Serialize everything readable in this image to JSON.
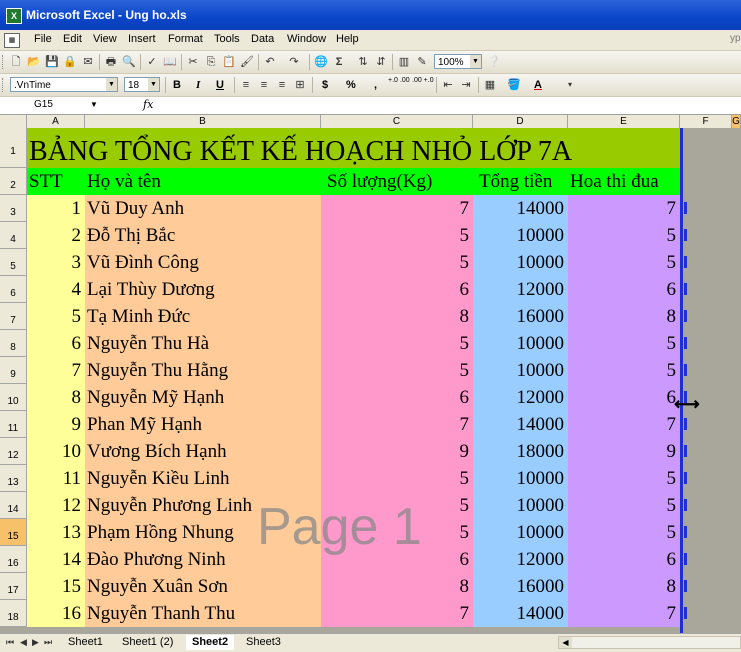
{
  "window": {
    "title": "Microsoft Excel - Ung ho.xls"
  },
  "menu": {
    "items": [
      "File",
      "Edit",
      "View",
      "Insert",
      "Format",
      "Tools",
      "Data",
      "Window",
      "Help"
    ],
    "edge_text": "ype"
  },
  "toolbar": {
    "zoom": "100%",
    "sum_icon": "Σ"
  },
  "format_toolbar": {
    "font_name": ".VnTime",
    "font_size": "18",
    "bold": "B",
    "italic": "I",
    "underline": "U",
    "currency": "$",
    "percent": "%",
    "comma": ",",
    "inc_dec": "+.0 .00",
    "dec_dec": ".00 +.0",
    "font_color": "A"
  },
  "formula_bar": {
    "name_box": "G15",
    "fx": "fx"
  },
  "columns": [
    "A",
    "B",
    "C",
    "D",
    "E",
    "F",
    "G"
  ],
  "rows": [
    "1",
    "2",
    "3",
    "4",
    "5",
    "6",
    "7",
    "8",
    "9",
    "10",
    "11",
    "12",
    "13",
    "14",
    "15",
    "16",
    "17",
    "18"
  ],
  "sheet": {
    "title": "BẢNG TỔNG KẾT KẾ HOẠCH NHỎ LỚP 7A",
    "headers": {
      "stt": "STT",
      "name": "Họ và tên",
      "qty": "Số lượng(Kg)",
      "total": "Tổng tiền",
      "award": "Hoa thi đua"
    },
    "records": [
      {
        "stt": "1",
        "name": "Vũ Duy Anh",
        "qty": "7",
        "total": "14000",
        "award": "7"
      },
      {
        "stt": "2",
        "name": "Đỗ Thị Bắc",
        "qty": "5",
        "total": "10000",
        "award": "5"
      },
      {
        "stt": "3",
        "name": "Vũ Đình Công",
        "qty": "5",
        "total": "10000",
        "award": "5"
      },
      {
        "stt": "4",
        "name": "Lại Thùy Dương",
        "qty": "6",
        "total": "12000",
        "award": "6"
      },
      {
        "stt": "5",
        "name": "Tạ Minh Đức",
        "qty": "8",
        "total": "16000",
        "award": "8"
      },
      {
        "stt": "6",
        "name": "Nguyễn Thu Hà",
        "qty": "5",
        "total": "10000",
        "award": "5"
      },
      {
        "stt": "7",
        "name": "Nguyễn Thu Hằng",
        "qty": "5",
        "total": "10000",
        "award": "5"
      },
      {
        "stt": "8",
        "name": "Nguyễn Mỹ Hạnh",
        "qty": "6",
        "total": "12000",
        "award": "6"
      },
      {
        "stt": "9",
        "name": "Phan Mỹ Hạnh",
        "qty": "7",
        "total": "14000",
        "award": "7"
      },
      {
        "stt": "10",
        "name": "Vương Bích Hạnh",
        "qty": "9",
        "total": "18000",
        "award": "9"
      },
      {
        "stt": "11",
        "name": "Nguyễn Kiều Linh",
        "qty": "5",
        "total": "10000",
        "award": "5"
      },
      {
        "stt": "12",
        "name": "Nguyễn Phương Linh",
        "qty": "5",
        "total": "10000",
        "award": "5"
      },
      {
        "stt": "13",
        "name": "Phạm Hồng Nhung",
        "qty": "5",
        "total": "10000",
        "award": "5"
      },
      {
        "stt": "14",
        "name": "Đào Phương Ninh",
        "qty": "6",
        "total": "12000",
        "award": "6"
      },
      {
        "stt": "15",
        "name": "Nguyễn Xuân Sơn",
        "qty": "8",
        "total": "16000",
        "award": "8"
      },
      {
        "stt": "16",
        "name": "Nguyễn Thanh Thu",
        "qty": "7",
        "total": "14000",
        "award": "7"
      }
    ]
  },
  "watermark": "Page 1",
  "sheet_tabs": [
    "Sheet1",
    "Sheet1 (2)",
    "Sheet2",
    "Sheet3"
  ],
  "active_tab": "Sheet2",
  "colors": {
    "title_bg": "#99cc00",
    "header_bg": "#00ff00",
    "col_a": "#ffff99",
    "col_b": "#ffcc99",
    "col_c": "#ff99cc",
    "col_d": "#99ccff",
    "col_e": "#cc99ff",
    "outside": "#a9a69b",
    "page_break": "#1f2fd0"
  }
}
